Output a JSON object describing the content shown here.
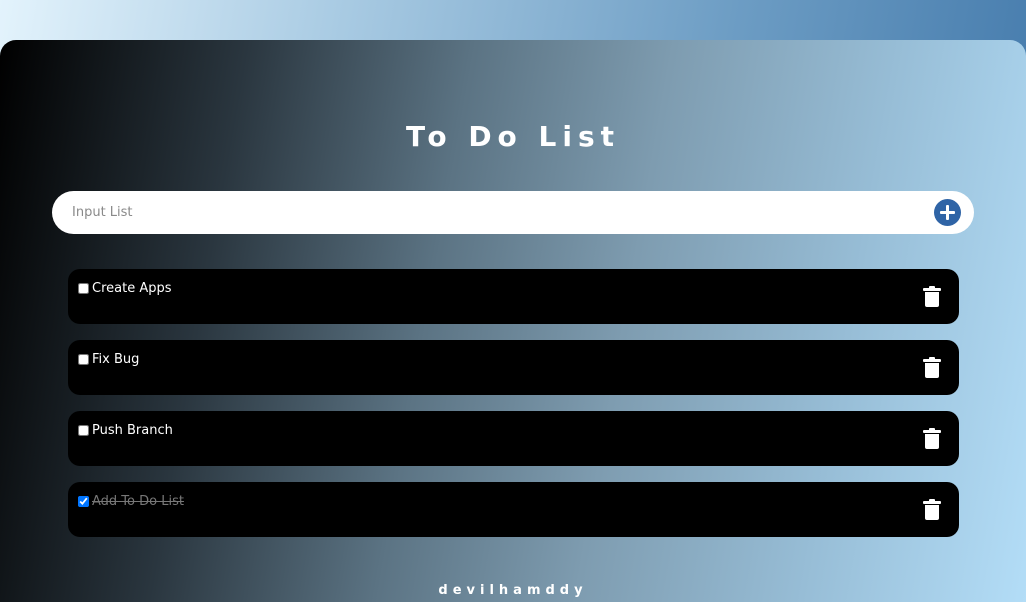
{
  "app": {
    "title": "To Do List",
    "footer": "devilhamddy"
  },
  "input": {
    "placeholder": "Input List",
    "value": "",
    "add_icon": "plus-circle-icon"
  },
  "todos": [
    {
      "label": "Create Apps",
      "checked": false
    },
    {
      "label": "Fix Bug",
      "checked": false
    },
    {
      "label": "Push Branch",
      "checked": false
    },
    {
      "label": "Add To Do List",
      "checked": true
    }
  ],
  "colors": {
    "accent": "#2f64a6",
    "item_bg": "#000000"
  }
}
